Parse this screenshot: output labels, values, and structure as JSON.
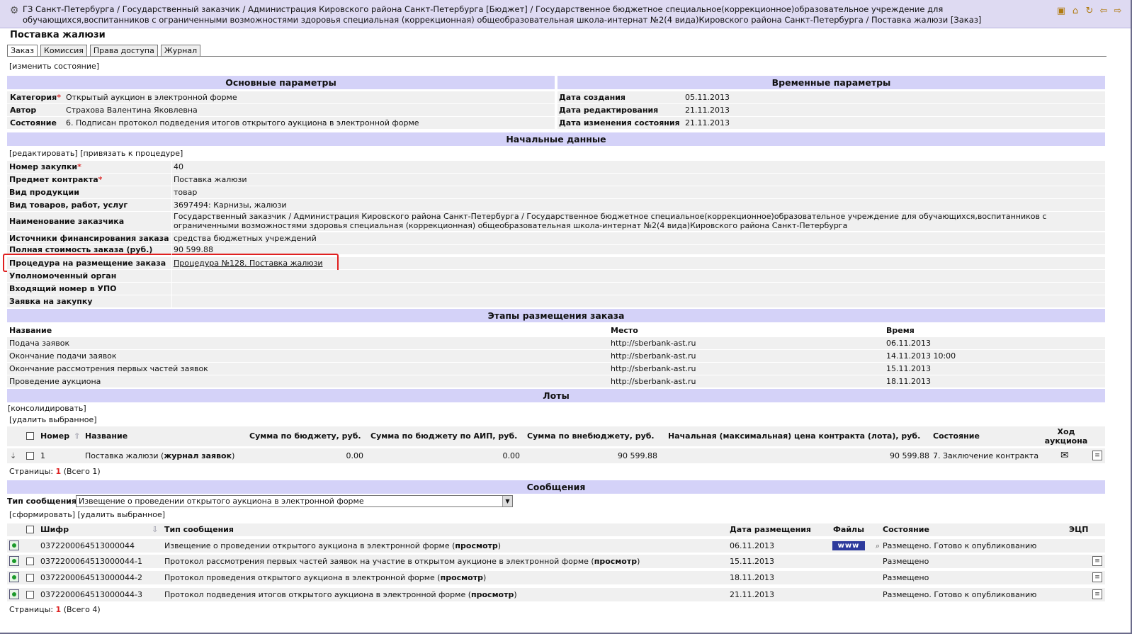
{
  "window": {
    "breadcrumb": "ГЗ Санкт-Петербурга / Государственный заказчик / Администрация Кировского района Санкт-Петербурга [Бюджет] / Государственное бюджетное специальное(коррекционное)образовательное учреждение для обучающихся,воспитанников с ограниченными возможностями здоровья специальная (коррекционная) общеобразовательная школа-интернат №2(4 вида)Кировского района Санкт-Петербурга / Поставка жалюзи [Заказ]"
  },
  "page_title": "Поставка жалюзи",
  "tabs": [
    "Заказ",
    "Комиссия",
    "Права доступа",
    "Журнал"
  ],
  "change_state_link": "[изменить состояние]",
  "main_params": {
    "title": "Основные параметры",
    "rows": [
      {
        "label": "Категория",
        "required": "*",
        "value": "Открытый аукцион в электронной форме"
      },
      {
        "label": "Автор",
        "value": "Страхова Валентина Яковлевна"
      },
      {
        "label": "Состояние",
        "value": "6. Подписан протокол подведения итогов открытого аукциона в электронной форме"
      }
    ]
  },
  "time_params": {
    "title": "Временные параметры",
    "rows": [
      {
        "label": "Дата создания",
        "value": "05.11.2013"
      },
      {
        "label": "Дата редактирования",
        "value": "21.11.2013"
      },
      {
        "label": "Дата изменения состояния",
        "value": "21.11.2013"
      }
    ]
  },
  "initial_data": {
    "title": "Начальные данные",
    "actions": "[редактировать] [привязать к процедуре]",
    "rows": [
      {
        "label": "Номер закупки",
        "required": "*",
        "value": "40"
      },
      {
        "label": "Предмет контракта",
        "required": "*",
        "value": "Поставка жалюзи"
      },
      {
        "label": "Вид продукции",
        "value": "товар"
      },
      {
        "label": "Вид товаров, работ, услуг",
        "value": "3697494: Карнизы, жалюзи"
      },
      {
        "label": "Наименование заказчика",
        "value": "Государственный заказчик / Администрация Кировского района Санкт-Петербурга / Государственное бюджетное специальное(коррекционное)образовательное учреждение для обучающихся,воспитанников с",
        "value2": "ограниченными возможностями здоровья специальная (коррекционная) общеобразовательная школа-интернат №2(4 вида)Кировского района Санкт-Петербурга"
      },
      {
        "label": "Источники финансирования заказа",
        "value": "средства бюджетных учреждений"
      },
      {
        "label": "Полная стоимость заказа (руб.)",
        "value": "90 599.88"
      },
      {
        "label": "Процедура на размещение заказа",
        "value": "Процедура №128. Поставка жалюзи"
      },
      {
        "label": "Уполномоченный орган",
        "value": ""
      },
      {
        "label": "Входящий номер в УПО",
        "value": ""
      },
      {
        "label": "Заявка на закупку",
        "value": ""
      }
    ]
  },
  "stages": {
    "title": "Этапы размещения заказа",
    "headers": [
      "Название",
      "Место",
      "Время"
    ],
    "rows": [
      [
        "Подача заявок",
        "http://sberbank-ast.ru",
        "06.11.2013"
      ],
      [
        "Окончание подачи заявок",
        "http://sberbank-ast.ru",
        "14.11.2013 10:00"
      ],
      [
        "Окончание рассмотрения первых частей заявок",
        "http://sberbank-ast.ru",
        "15.11.2013"
      ],
      [
        "Проведение аукциона",
        "http://sberbank-ast.ru",
        "18.11.2013"
      ]
    ]
  },
  "lots": {
    "title": "Лоты",
    "consolidate": "[консолидировать]",
    "delete_selected": "[удалить выбранное]",
    "headers": [
      "Номер",
      "Название",
      "Сумма по бюджету, руб.",
      "Сумма по бюджету по АИП, руб.",
      "Сумма по внебюджету, руб.",
      "Начальная (максимальная) цена контракта (лота), руб.",
      "Состояние",
      "Ход аукциона"
    ],
    "rows": [
      {
        "number": "1",
        "name": "Поставка жалюзи",
        "journal": "журнал заявок",
        "budget": "0.00",
        "aip": "0.00",
        "extra": "90 599.88",
        "price": "90 599.88",
        "state": "7. Заключение контракта"
      }
    ],
    "pager_label": "Страницы:",
    "pager_page": "1",
    "pager_total": "(Всего 1)"
  },
  "messages": {
    "title": "Сообщения",
    "type_label": "Тип сообщения",
    "type_value": "Извещение о проведении открытого аукциона в электронной форме",
    "actions": "[сформировать] [удалить выбранное]",
    "headers": [
      "Шифр",
      "Тип сообщения",
      "Дата размещения",
      "Файлы",
      "Состояние",
      "ЭЦП"
    ],
    "rows": [
      {
        "code": "0372200064513000044",
        "type": "Извещение о проведении открытого аукциона в электронной форме",
        "view": "просмотр",
        "date": "06.11.2013",
        "state": "Размещено. Готово к опубликованию"
      },
      {
        "code": "0372200064513000044-1",
        "type": "Протокол рассмотрения первых частей заявок на участие в открытом аукционе в электронной форме",
        "view": "просмотр",
        "date": "15.11.2013",
        "state": "Размещено"
      },
      {
        "code": "0372200064513000044-2",
        "type": "Протокол проведения открытого аукциона в электронной форме",
        "view": "просмотр",
        "date": "18.11.2013",
        "state": "Размещено"
      },
      {
        "code": "0372200064513000044-3",
        "type": "Протокол подведения итогов открытого аукциона в электронной форме",
        "view": "просмотр",
        "date": "21.11.2013",
        "state": "Размещено. Готово к опубликованию"
      }
    ],
    "www_label": "www",
    "pager_label": "Страницы:",
    "pager_page": "1",
    "pager_total": "(Всего 4)"
  },
  "colors": {
    "section": "#d4d2f8",
    "highlight": "#e02020",
    "titlebar": "#dedaf2"
  }
}
